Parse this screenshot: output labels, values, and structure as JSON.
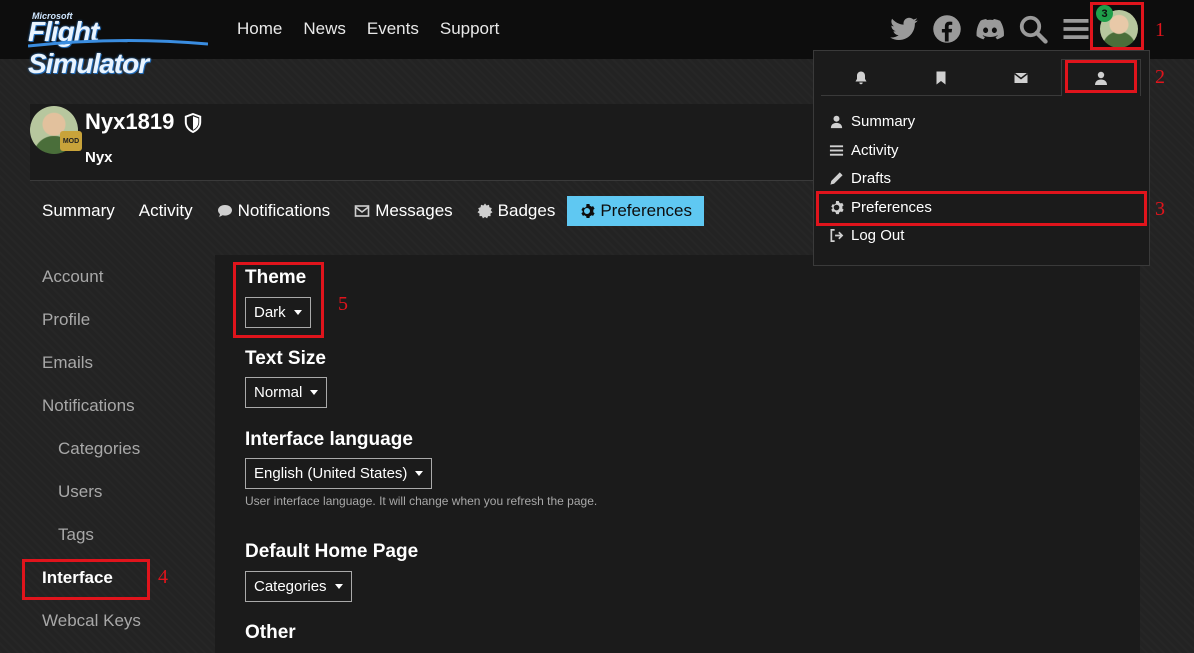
{
  "topbar": {
    "logo_small": "Microsoft",
    "logo_main": "Flight Simulator",
    "nav": [
      "Home",
      "News",
      "Events",
      "Support"
    ],
    "notification_count": "3",
    "icons": [
      "twitter-icon",
      "facebook-icon",
      "discord-icon",
      "search-icon",
      "hamburger-icon"
    ]
  },
  "profile": {
    "username": "Nyx1819",
    "name": "Nyx",
    "badge": "MOD"
  },
  "tabs": [
    {
      "label": "Summary"
    },
    {
      "label": "Activity"
    },
    {
      "label": "Notifications"
    },
    {
      "label": "Messages"
    },
    {
      "label": "Badges"
    },
    {
      "label": "Preferences"
    }
  ],
  "sidebar": {
    "items": [
      "Account",
      "Profile",
      "Emails",
      "Notifications",
      "Categories",
      "Users",
      "Tags",
      "Interface",
      "Webcal Keys"
    ],
    "active": "Interface"
  },
  "preferences": {
    "theme_label": "Theme",
    "theme_value": "Dark",
    "text_size_label": "Text Size",
    "text_size_value": "Normal",
    "language_label": "Interface language",
    "language_value": "English (United States)",
    "language_hint": "User interface language. It will change when you refresh the page.",
    "home_label": "Default Home Page",
    "home_value": "Categories",
    "other_label": "Other"
  },
  "user_menu": {
    "tab_icons": [
      "bell-icon",
      "bookmark-icon",
      "envelope-icon",
      "user-icon"
    ],
    "items": [
      "Summary",
      "Activity",
      "Drafts",
      "Preferences",
      "Log Out"
    ]
  },
  "annotations": [
    "1",
    "2",
    "3",
    "4",
    "5"
  ],
  "colors": {
    "accent": "#5fc8f2",
    "highlight_box": "#e0141c",
    "badge_green": "#1f9f4a",
    "panel_bg": "#1b1b1b"
  }
}
